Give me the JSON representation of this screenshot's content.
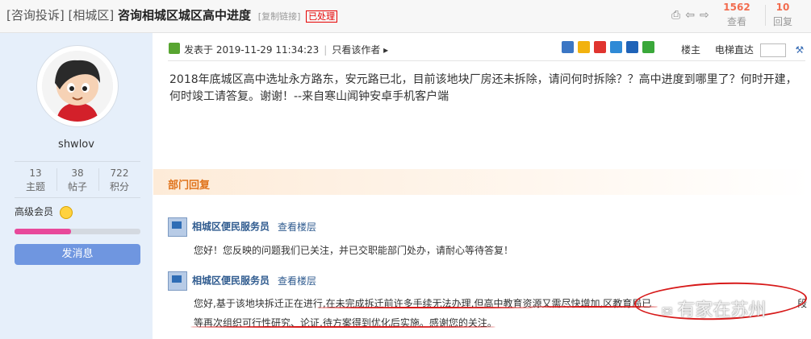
{
  "header": {
    "category": "[咨询投诉]",
    "district": "[相城区]",
    "title": "咨询相城区城区高中进度",
    "copy_link": "[复制链接]",
    "status_badge": "已处理",
    "views_count": "1562",
    "views_label": "查看",
    "replies_count": "10",
    "replies_label": "回复"
  },
  "user": {
    "name": "shwlov",
    "stats": [
      {
        "value": "13",
        "label": "主题"
      },
      {
        "value": "38",
        "label": "帖子"
      },
      {
        "value": "722",
        "label": "积分"
      }
    ],
    "level": "高级会员",
    "level_progress": 0.45,
    "message_button": "发消息"
  },
  "post": {
    "posted_label": "发表于 2019-11-29 11:34:23",
    "author_only": "只看该作者",
    "floor_label": "楼主",
    "jump_label": "电梯直达",
    "content": "2018年底城区高中选址永方路东，安元路已北，目前该地块厂房还未拆除，请问何时拆除？？高中进度到哪里了？何时开建，何时竣工请答复。谢谢！--来自寒山闻钟安卓手机客户端"
  },
  "department": {
    "section_label": "部门回复",
    "replies": [
      {
        "author": "相城区便民服务员",
        "view_floor": "查看楼层",
        "text": "您好！您反映的问题我们已关注，并已交职能部门处办，请耐心等待答复！"
      },
      {
        "author": "相城区便民服务员",
        "view_floor": "查看楼层",
        "text_line1": "您好,基于该地块拆迁正在进行,在未完成拆迁前许多手续无法办理,但高中教育资源又需尽快增加,区教育局已",
        "text_line1_end": "段",
        "text_line2": "等再次组织可行性研究、论证,待方案得到优化后实施。感谢您的关注。"
      }
    ]
  },
  "watermark": "有家在苏州",
  "colors": {
    "accent_orange": "#f26c4f",
    "badge_red": "#e60000",
    "sidebar_bg": "#e6effa",
    "button_blue": "#6f96e0",
    "progress_pink": "#e8499b",
    "annotation_red": "#d71a1a"
  }
}
